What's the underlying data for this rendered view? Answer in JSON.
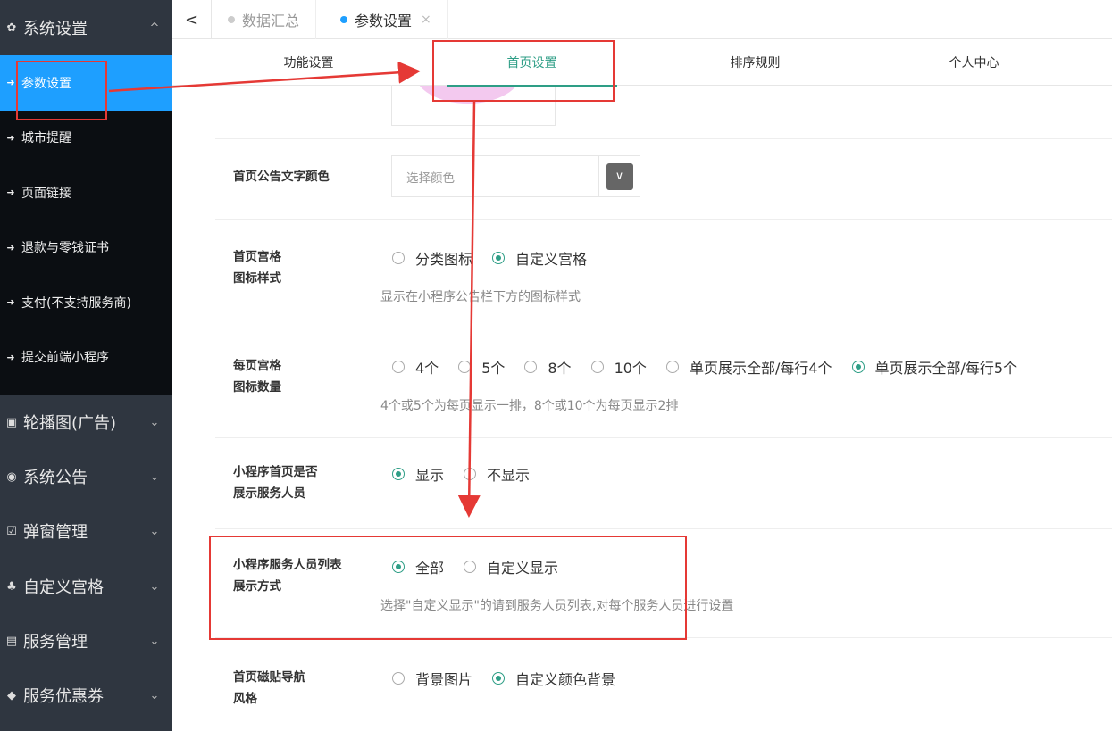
{
  "sidebar": {
    "groups": [
      {
        "icon": "gear-icon",
        "glyph": "✿",
        "label": "系统设置",
        "chevron": "^"
      },
      {
        "icon": "image-icon",
        "glyph": "▣",
        "label": "轮播图(广告)",
        "chevron": "⌄"
      },
      {
        "icon": "megaphone-icon",
        "glyph": "◉",
        "label": "系统公告",
        "chevron": "⌄"
      },
      {
        "icon": "checkbox-icon",
        "glyph": "☑",
        "label": "弹窗管理",
        "chevron": "⌄"
      },
      {
        "icon": "sitemap-icon",
        "glyph": "♣",
        "label": "自定义宫格",
        "chevron": "⌄"
      },
      {
        "icon": "server-icon",
        "glyph": "▤",
        "label": "服务管理",
        "chevron": "⌄"
      },
      {
        "icon": "tag-icon",
        "glyph": "◆",
        "label": "服务优惠券",
        "chevron": "⌄"
      }
    ],
    "sub_items": [
      {
        "icon": "sign-in-icon",
        "glyph": "➜",
        "label": "参数设置",
        "active": true
      },
      {
        "icon": "sign-in-icon",
        "glyph": "➜",
        "label": "城市提醒"
      },
      {
        "icon": "sign-in-icon",
        "glyph": "➜",
        "label": "页面链接"
      },
      {
        "icon": "sign-in-icon",
        "glyph": "➜",
        "label": "退款与零钱证书"
      },
      {
        "icon": "sign-in-icon",
        "glyph": "➜",
        "label": "支付(不支持服务商)"
      },
      {
        "icon": "sign-in-icon",
        "glyph": "➜",
        "label": "提交前端小程序"
      }
    ]
  },
  "topbar": {
    "back_glyph": "<",
    "tabs": [
      {
        "label": "数据汇总"
      },
      {
        "label": "参数设置",
        "close": "×"
      }
    ]
  },
  "subtabs": [
    "功能设置",
    "首页设置",
    "排序规则",
    "个人中心"
  ],
  "settings": {
    "notice_color": {
      "label": "首页公告文字颜色",
      "placeholder": "选择颜色",
      "button_glyph": "∨"
    },
    "grid_style": {
      "label_line1": "首页宫格",
      "label_line2": "图标样式",
      "options": [
        "分类图标",
        "自定义宫格"
      ],
      "selected": 1,
      "hint": "显示在小程序公告栏下方的图标样式"
    },
    "grid_count": {
      "label_line1": "每页宫格",
      "label_line2": "图标数量",
      "options": [
        "4个",
        "5个",
        "8个",
        "10个",
        "单页展示全部/每行4个",
        "单页展示全部/每行5个"
      ],
      "selected": 5,
      "hint": "4个或5个为每页显示一排，8个或10个为每页显示2排"
    },
    "show_staff": {
      "label_line1": "小程序首页是否",
      "label_line2": "展示服务人员",
      "options": [
        "显示",
        "不显示"
      ],
      "selected": 0
    },
    "staff_list": {
      "label_line1": "小程序服务人员列表",
      "label_line2": "展示方式",
      "options": [
        "全部",
        "自定义显示"
      ],
      "selected": 0,
      "hint": "选择\"自定义显示\"的请到服务人员列表,对每个服务人员进行设置"
    },
    "tile_nav": {
      "label_line1": "首页磁贴导航",
      "label_line2": "风格",
      "options": [
        "背景图片",
        "自定义颜色背景"
      ],
      "selected": 1
    }
  },
  "colors": {
    "accent": "#2e9e86",
    "active_menu": "#1e9fff",
    "annotation": "#e53935"
  }
}
